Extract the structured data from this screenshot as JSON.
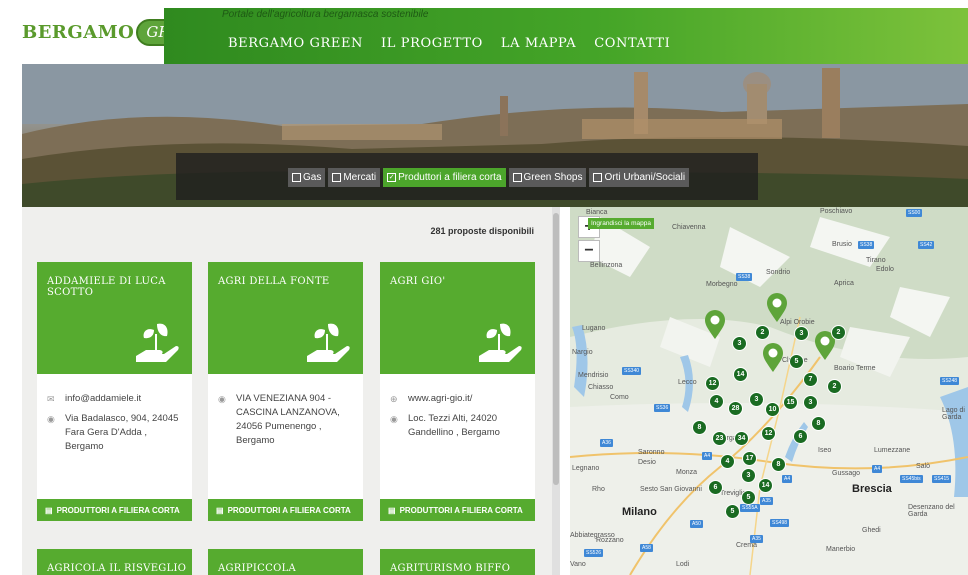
{
  "header": {
    "logo_word": "BERGAMO",
    "logo_pill": "GREEN",
    "tagline": "Portale dell'agricoltura bergamasca sostenibile",
    "nav": [
      "BERGAMO GREEN",
      "IL PROGETTO",
      "LA MAPPA",
      "CONTATTI"
    ]
  },
  "filters": [
    {
      "label": "Gas",
      "active": false
    },
    {
      "label": "Mercati",
      "active": false
    },
    {
      "label": "Produttori a filiera corta",
      "active": true
    },
    {
      "label": "Green Shops",
      "active": false
    },
    {
      "label": "Orti Urbani/Sociali",
      "active": false
    }
  ],
  "list": {
    "count_text": "281 proposte disponibili",
    "cards": [
      {
        "title": "ADDAMIELE DI LUCA SCOTTO",
        "line1": "info@addamiele.it",
        "line2": "Via Badalasco, 904, 24045 Fara Gera D'Adda , Bergamo",
        "category": "PRODUTTORI A FILIERA CORTA"
      },
      {
        "title": "AGRI DELLA FONTE",
        "line1": "",
        "line2": "VIA VENEZIANA 904 - CASCINA LANZANOVA, 24056 Pumenengo , Bergamo",
        "category": "PRODUTTORI A FILIERA CORTA"
      },
      {
        "title": "AGRI GIO'",
        "line1": "www.agri-gio.it/",
        "line2": "Loc. Tezzi Alti, 24020 Gandellino , Bergamo",
        "category": "PRODUTTORI A FILIERA CORTA"
      }
    ],
    "next_cards": [
      "AGRICOLA IL RISVEGLIO",
      "AGRIPICCOLA",
      "AGRITURISMO BIFFO"
    ]
  },
  "map": {
    "enlarge_label": "Ingrandisci la mappa",
    "zoom_in": "+",
    "zoom_out": "−",
    "places": [
      "Bianca",
      "Chiavenna",
      "Poschiavo",
      "Brusio",
      "Bellinzona",
      "Tirano",
      "Sondrio",
      "Edolo",
      "Morbegno",
      "Aprica",
      "Lugano",
      "Alpi Orobie",
      "Clusone",
      "Boario Terme",
      "Mendrisio",
      "Chiasso",
      "Lecco",
      "Como",
      "Bergamo",
      "Iseo",
      "Lumezzane",
      "Saronno",
      "Desio",
      "Monza",
      "Legnano",
      "Treviglio",
      "Gussago",
      "Salò",
      "Rho",
      "Sesto San Giovanni",
      "Brescia",
      "Milano",
      "Desenzano del Garda",
      "Lago di Garda",
      "Crema",
      "Ghedi",
      "Rozzano",
      "Lodi",
      "Manerbio",
      "Abbiategrasso",
      "Vano",
      "Nargio"
    ],
    "clusters": [
      "2",
      "3",
      "3",
      "2",
      "5",
      "14",
      "7",
      "2",
      "12",
      "3",
      "4",
      "28",
      "10",
      "15",
      "3",
      "8",
      "8",
      "23",
      "34",
      "12",
      "6",
      "4",
      "17",
      "8",
      "3",
      "14",
      "6",
      "5",
      "5"
    ],
    "highways": [
      "SS00",
      "SS38",
      "SS42",
      "SS38",
      "SS340",
      "SS36",
      "SS248",
      "A36",
      "A4",
      "A4",
      "A4",
      "SS498",
      "SS55A",
      "SS415",
      "A50",
      "A58",
      "SS526",
      "SS45bis",
      "A35",
      "A35"
    ]
  }
}
